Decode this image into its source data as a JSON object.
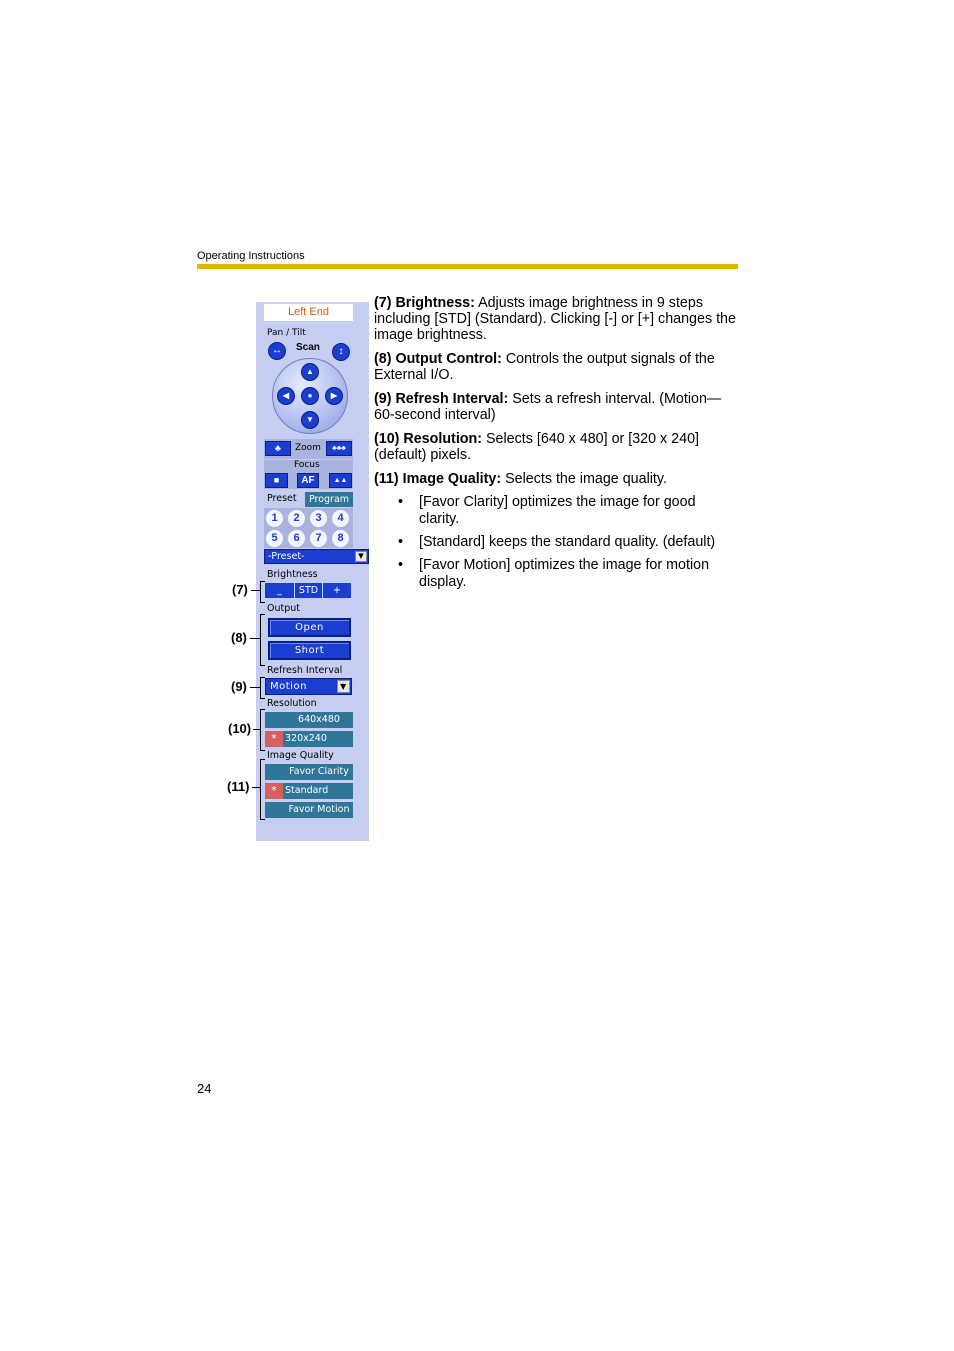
{
  "page": {
    "running_header": "Operating Instructions",
    "page_number": "24",
    "accent_color": "#dcb800"
  },
  "panel": {
    "status": "Left End",
    "pan_tilt_label": "Pan / Tilt",
    "scan_label": "Scan",
    "icons": {
      "scan_horizontal": "left-right-arrow-icon",
      "scan_vertical": "up-down-arrow-icon",
      "up": "up-arrow-icon",
      "down": "down-arrow-icon",
      "left": "left-arrow-icon",
      "right": "right-arrow-icon",
      "home": "home-dot-icon",
      "zoom_wide": "zoom-wide-icon",
      "zoom_tele": "zoom-tele-icon",
      "focus_near": "focus-near-icon",
      "focus_far": "focus-far-icon"
    },
    "glyphs": {
      "left_right": "↔",
      "up_down": "↕",
      "up": "▲",
      "down": "▼",
      "left": "◀",
      "right": "▶",
      "home": "●",
      "zoom_wide": "♣",
      "zoom_tele": "♣♣♣",
      "focus_near": "■",
      "focus_far": "▲▲",
      "dropdown": "▼",
      "star": "*"
    },
    "zoom_label": "Zoom",
    "focus_label": "Focus",
    "af_label": "AF",
    "preset_label": "Preset",
    "program_label": "Program",
    "preset_numbers": [
      "1",
      "2",
      "3",
      "4",
      "5",
      "6",
      "7",
      "8"
    ],
    "preset_select_value": "-Preset-",
    "brightness": {
      "label": "Brightness",
      "buttons": [
        "_",
        "STD",
        "+"
      ]
    },
    "output": {
      "label": "Output",
      "buttons": [
        "Open",
        "Short"
      ]
    },
    "refresh_interval": {
      "label": "Refresh Interval",
      "value": "Motion"
    },
    "resolution": {
      "label": "Resolution",
      "options": [
        {
          "label": "640x480",
          "selected": false
        },
        {
          "label": "320x240",
          "selected": true
        }
      ]
    },
    "image_quality": {
      "label": "Image Quality",
      "options": [
        {
          "label": "Favor Clarity",
          "selected": false
        },
        {
          "label": "Standard",
          "selected": true
        },
        {
          "label": "Favor Motion",
          "selected": false
        }
      ]
    },
    "colors": {
      "panel_bg": "#c5cdf0",
      "button_blue": "#1a3fd0",
      "teal": "#2f7699",
      "selected_marker": "#d56060",
      "status_text": "#e05a10"
    }
  },
  "callouts": [
    "(7)",
    "(8)",
    "(9)",
    "(10)",
    "(11)"
  ],
  "descriptions": [
    {
      "title": "(7) Brightness:",
      "text": " Adjusts image brightness in 9 steps including [STD] (Standard). Clicking [-] or [+] changes the image brightness."
    },
    {
      "title": "(8) Output Control:",
      "text": " Controls the output signals of the External I/O."
    },
    {
      "title": "(9) Refresh Interval:",
      "text": " Sets a refresh interval. (Motion—60-second interval)"
    },
    {
      "title": "(10) Resolution:",
      "text": " Selects [640 x 480] or [320 x 240] (default) pixels."
    },
    {
      "title": "(11) Image Quality:",
      "text": " Selects the image quality."
    }
  ],
  "bullets": [
    "[Favor Clarity] optimizes the image for good clarity.",
    "[Standard] keeps the standard quality. (default)",
    "[Favor Motion] optimizes the image for motion display."
  ],
  "bullet_char": "•"
}
